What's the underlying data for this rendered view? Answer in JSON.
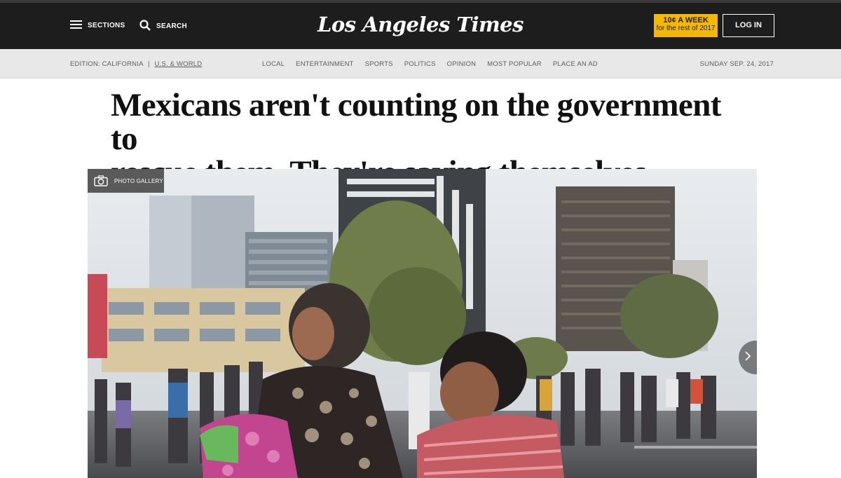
{
  "topbar": {
    "sections_label": "SECTIONS",
    "search_label": "SEARCH",
    "logo_text": "Los Angeles Times",
    "promo_line1": "10¢ A WEEK",
    "promo_line2": "for the rest of 2017",
    "login_label": "LOG IN"
  },
  "subnav": {
    "edition_label": "EDITION: CALIFORNIA",
    "edition_separator": "|",
    "edition_world": "U.S. & WORLD",
    "menu": [
      {
        "label": "LOCAL"
      },
      {
        "label": "ENTERTAINMENT"
      },
      {
        "label": "SPORTS"
      },
      {
        "label": "POLITICS"
      },
      {
        "label": "OPINION"
      },
      {
        "label": "MOST POPULAR"
      },
      {
        "label": "PLACE AN AD"
      }
    ],
    "date": "SUNDAY SEP. 24, 2017"
  },
  "article": {
    "headline_line1": "Mexicans aren't counting on the government to",
    "headline_line2": "rescue them. They're saving themselves"
  },
  "hero": {
    "gallery_label": "PHOTO GALLERY",
    "icons": [
      "camera-icon",
      "chevron-right-icon",
      "menu-icon",
      "search-icon"
    ]
  },
  "colors": {
    "topbar_bg": "#1d1d1d",
    "promo_bg": "#f5b800",
    "subnav_bg": "#e8e8e8",
    "headline": "#111111"
  }
}
